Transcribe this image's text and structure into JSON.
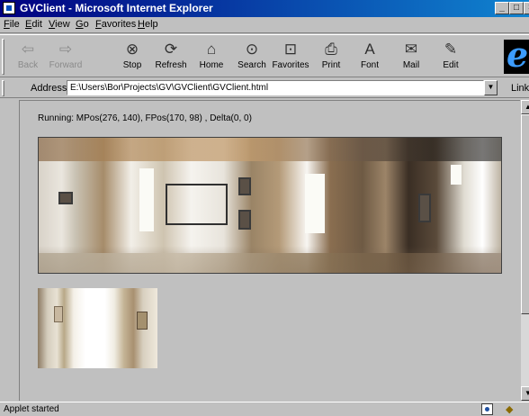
{
  "window": {
    "title": "GVClient - Microsoft Internet Explorer",
    "controls": {
      "minimize": "_",
      "restore": "□",
      "close": "×"
    }
  },
  "menu": [
    "File",
    "Edit",
    "View",
    "Go",
    "Favorites",
    "Help"
  ],
  "toolbar": [
    {
      "label": "Back",
      "icon": "back-arrow-icon",
      "glyph": "⇦",
      "enabled": false
    },
    {
      "label": "Forward",
      "icon": "forward-arrow-icon",
      "glyph": "⇨",
      "enabled": false
    },
    {
      "label": "Stop",
      "icon": "stop-icon",
      "glyph": "⊗",
      "enabled": true
    },
    {
      "label": "Refresh",
      "icon": "refresh-icon",
      "glyph": "⟳",
      "enabled": true
    },
    {
      "label": "Home",
      "icon": "home-icon",
      "glyph": "⌂",
      "enabled": true
    },
    {
      "label": "Search",
      "icon": "search-icon",
      "glyph": "⊙",
      "enabled": true
    },
    {
      "label": "Favorites",
      "icon": "favorites-icon",
      "glyph": "⊡",
      "enabled": true
    },
    {
      "label": "Print",
      "icon": "print-icon",
      "glyph": "⎙",
      "enabled": true
    },
    {
      "label": "Font",
      "icon": "font-icon",
      "glyph": "A",
      "enabled": true
    },
    {
      "label": "Mail",
      "icon": "mail-icon",
      "glyph": "✉",
      "enabled": true
    },
    {
      "label": "Edit",
      "icon": "edit-icon",
      "glyph": "✎",
      "enabled": true
    }
  ],
  "address": {
    "label": "Address",
    "value": "E:\\Users\\Bor\\Projects\\GV\\GVClient\\GVClient.html",
    "links": "Links"
  },
  "applet": {
    "status": "Running: MPos(276, 140),  FPos(170, 98) ,  Delta(0, 0)"
  },
  "statusbar": {
    "text": "Applet started"
  }
}
